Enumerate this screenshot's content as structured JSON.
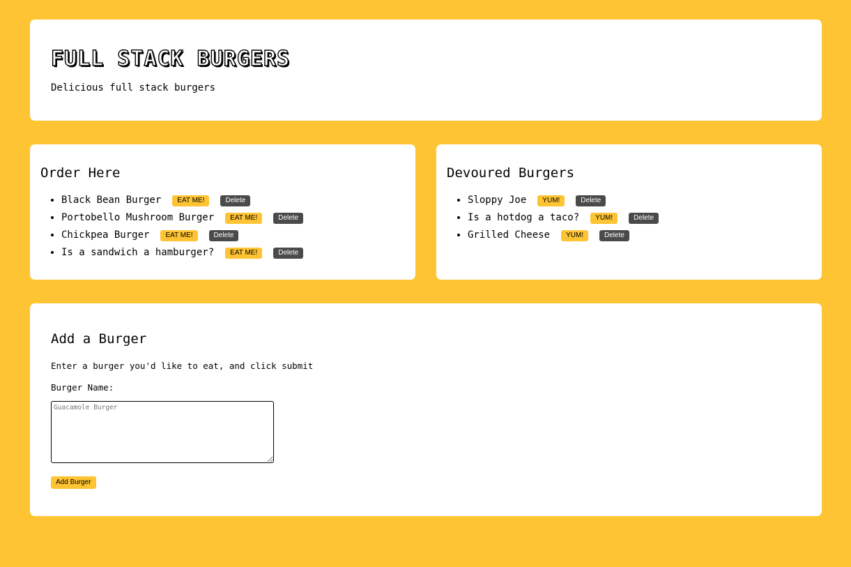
{
  "header": {
    "title": "FULL STACK BURGERS",
    "subtitle": "Delicious full stack burgers"
  },
  "order": {
    "heading": "Order Here",
    "eat_label": "EAT ME!",
    "delete_label": "Delete",
    "items": [
      {
        "name": "Black Bean Burger"
      },
      {
        "name": "Portobello Mushroom Burger"
      },
      {
        "name": "Chickpea Burger"
      },
      {
        "name": "Is a sandwich a hamburger?"
      }
    ]
  },
  "devoured": {
    "heading": "Devoured Burgers",
    "yum_label": "YUM!",
    "delete_label": "Delete",
    "items": [
      {
        "name": "Sloppy Joe"
      },
      {
        "name": "Is a hotdog a taco?"
      },
      {
        "name": "Grilled Cheese"
      }
    ]
  },
  "add": {
    "heading": "Add a Burger",
    "description": "Enter a burger you'd like to eat, and click submit",
    "field_label": "Burger Name:",
    "placeholder": "Guacamole Burger",
    "value": "",
    "submit_label": "Add Burger"
  },
  "colors": {
    "background": "#ffc433",
    "accent": "#ffc433",
    "delete_button": "#4a4a4a"
  }
}
